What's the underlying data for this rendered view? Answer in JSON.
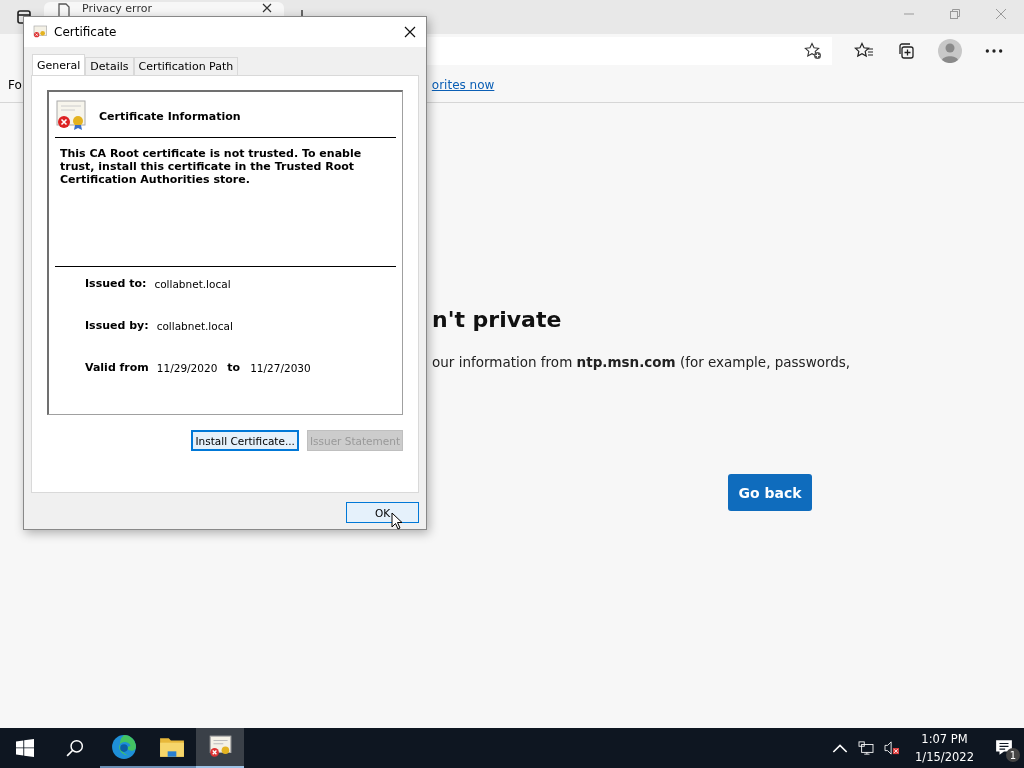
{
  "browser": {
    "tab": {
      "title": "Privacy error"
    },
    "favorites_bar": {
      "text": "Fo",
      "link": "orites now"
    },
    "page": {
      "heading": "n't private",
      "message": "our information from **ntp.msn.com** (for example, passwords,",
      "button": "Go back"
    }
  },
  "dialog": {
    "title": "Certificate",
    "tabs": [
      {
        "label": "General",
        "selected": true
      },
      {
        "label": "Details",
        "selected": false
      },
      {
        "label": "Certification Path",
        "selected": false
      }
    ],
    "heading": "Certificate Information",
    "warning": "This CA Root certificate is not trusted. To enable trust, install this certificate in the Trusted Root Certification Authorities store.",
    "fields": [
      {
        "label": "Issued to:",
        "value": "collabnet.local"
      },
      {
        "label": "Issued by:",
        "value": "collabnet.local"
      }
    ],
    "validity": {
      "label": "Valid from",
      "from": "11/29/2020",
      "to_label": "to",
      "to": "11/27/2030"
    },
    "buttons": [
      {
        "label": "Install Certificate...",
        "disabled": false,
        "focused": true
      },
      {
        "label": "Issuer Statement",
        "disabled": true,
        "focused": false
      }
    ],
    "ok": "OK"
  },
  "taskbar": {
    "apps": [
      {
        "kind": "edge",
        "active": false
      },
      {
        "kind": "explorer",
        "active": false
      },
      {
        "kind": "certificate",
        "active": true
      }
    ],
    "time": "1:07 PM",
    "date": "1/15/2022",
    "notifications": "1"
  }
}
